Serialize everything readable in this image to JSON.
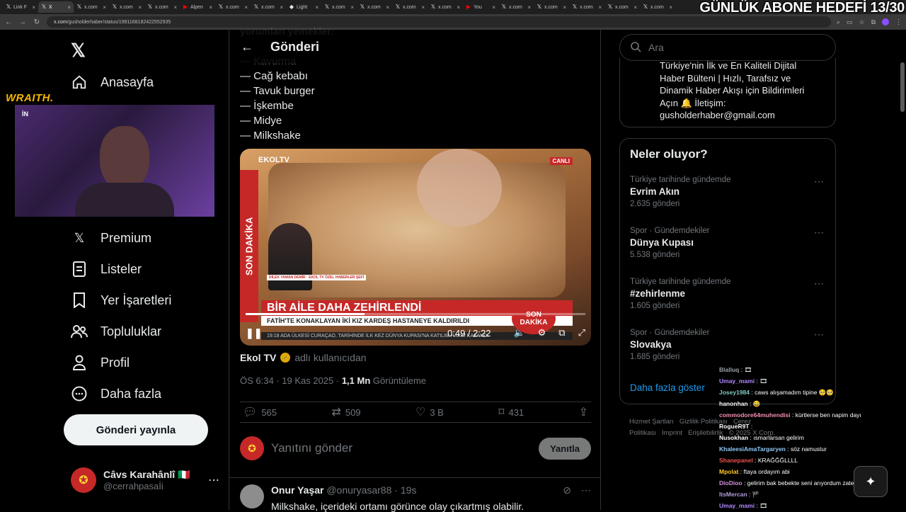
{
  "browser": {
    "tabs": [
      {
        "label": "Link F",
        "icon": "x"
      },
      {
        "label": "X",
        "icon": "x",
        "active": true
      },
      {
        "label": "x.com",
        "icon": "x"
      },
      {
        "label": "x.com",
        "icon": "x"
      },
      {
        "label": "x.com",
        "icon": "x"
      },
      {
        "label": "Alpen",
        "icon": "youtube"
      },
      {
        "label": "x.com",
        "icon": "x"
      },
      {
        "label": "x.com",
        "icon": "x"
      },
      {
        "label": "Light",
        "icon": "link"
      },
      {
        "label": "x.com",
        "icon": "x"
      },
      {
        "label": "x.com",
        "icon": "x"
      },
      {
        "label": "x.com",
        "icon": "x"
      },
      {
        "label": "x.com",
        "icon": "x"
      },
      {
        "label": "You",
        "icon": "youtube"
      },
      {
        "label": "x.com",
        "icon": "x"
      },
      {
        "label": "x.com",
        "icon": "x"
      },
      {
        "label": "x.com",
        "icon": "x"
      },
      {
        "label": "x.com",
        "icon": "x"
      },
      {
        "label": "x.com",
        "icon": "x"
      }
    ],
    "url_host": "x.com",
    "url_path": "/gusholderhaber/status/1991168182422552935"
  },
  "overlay": {
    "title": "GÜNLÜK ABONE HEDEFİ 13/30",
    "brand": "WRAITH.",
    "cam_tag": "İN"
  },
  "nav": {
    "home": "Anasayfa",
    "premium": "Premium",
    "lists": "Listeler",
    "bookmarks": "Yer İşaretleri",
    "communities": "Topluluklar",
    "profile": "Profil",
    "more": "Daha fazla",
    "post_button": "Gönderi yayınla"
  },
  "account": {
    "name": "Câvs Karahânlî 🇮🇹",
    "handle": "@cerrahpasaİi"
  },
  "main": {
    "header_title": "Gönderi",
    "faded_line": "yorumları yemekler:",
    "food_list": [
      "— Kavurma",
      "— Cağ kebabı",
      "— Tavuk burger",
      "— İşkembe",
      "— Midye",
      "— Milkshake"
    ],
    "video": {
      "channel": "EKOLTV",
      "live": "CANLI",
      "side_banner": "SON DAKİKA",
      "headline": "BİR AİLE DAHA ZEHİRLENDİ",
      "subline": "FATİH'TE KONAKLAYAN İKİ KIZ KARDEŞ HASTANEYE KALDIRILDI",
      "ticker": "19:18   ADA ÜLKESİ CURAÇAO, TARİHİNDE İLK KEZ DÜNYA KUPASI'NA KATILIM HAKKI KAZANDI",
      "badge": "SON DAKİKA",
      "anchor_caption": "DİLEK YAMAN DEMİR · EKOL TV ÖZEL HABERLER ŞEFİ",
      "time": "0:49 / 2:22",
      "progress": 0.35
    },
    "attribution_name": "Ekol TV",
    "attribution_suffix": "adlı kullanıcıdan",
    "timestamp": "ÖS 6:34 · 19 Kas 2025 · ",
    "views": "1,1 Mn",
    "views_label": " Görüntüleme",
    "actions": {
      "replies": "565",
      "reposts": "509",
      "likes": "3 B",
      "bookmarks": "431"
    },
    "reply_placeholder": "Yanıtını gönder",
    "reply_button": "Yanıtla",
    "comment": {
      "name": "Onur Yaşar",
      "handle": "@onuryasar88 · 19s",
      "text": "Milkshake, içerideki ortamı görünce olay çıkartmış olabilir."
    }
  },
  "right": {
    "search_placeholder": "Ara",
    "bio": "Türkiye'nin İlk ve En Kaliteli Dijital Haber Bülteni | Hızlı, Tarafsız ve Dinamik Haber Akışı için Bildirimleri Açın 🔔 İletişim: gusholderhaber@gmail.com",
    "trends_title": "Neler oluyor?",
    "trends": [
      {
        "context": "Türkiye tarihinde gündemde",
        "topic": "Evrim Akın",
        "count": "2.635 gönderi"
      },
      {
        "context": "Spor · Gündemdekiler",
        "topic": "Dünya Kupası",
        "count": "5.538 gönderi"
      },
      {
        "context": "Türkiye tarihinde gündemde",
        "topic": "#zehirlenme",
        "count": "1.605 gönderi"
      },
      {
        "context": "Spor · Gündemdekiler",
        "topic": "Slovakya",
        "count": "1.685 gönderi"
      }
    ],
    "show_more": "Daha fazla göster",
    "footer": [
      "Hizmet Şartları",
      "Gizlilik Politikası",
      "Çerez Politikası",
      "Imprint",
      "Erişilebilirlik",
      "© 2025 X Corp."
    ]
  },
  "chat": [
    {
      "user": "Blalluq",
      "msg": "🎞",
      "color": "#9aa0a6"
    },
    {
      "user": "Umay_mami",
      "msg": "🎞",
      "color": "#b388ff"
    },
    {
      "user": "Josey1984",
      "msg": "caws alışamadım tipine 🥺🥺",
      "color": "#80cbc4"
    },
    {
      "user": "hanonhan",
      "msg": "😂",
      "color": "#ffffff"
    },
    {
      "user": "commodore64muhendisi",
      "msg": "kürtlerse ben napim dayı",
      "color": "#f48fb1"
    },
    {
      "user": "RogueR9T",
      "msg": "",
      "color": "#ffffff"
    },
    {
      "user": "Nusokhan",
      "msg": "ısmarlarsan gelirim",
      "color": "#ffffff"
    },
    {
      "user": "KhaleesiAmaTargaryen",
      "msg": "söz namustur",
      "color": "#90caf9"
    },
    {
      "user": "Shanepanel",
      "msg": "KRAĞĞĞLLLL",
      "color": "#ef5350"
    },
    {
      "user": "Mpolat",
      "msg": "ftaya ordayım abi",
      "color": "#ffca28"
    },
    {
      "user": "DioDioo",
      "msg": "gelirim bak bebekte seni arıyordum zaten",
      "color": "#ce93d8"
    },
    {
      "user": "ItsMercan",
      "msg": "🏴",
      "color": "#b39ddb"
    },
    {
      "user": "Umay_mami",
      "msg": "🎞",
      "color": "#b388ff"
    }
  ]
}
